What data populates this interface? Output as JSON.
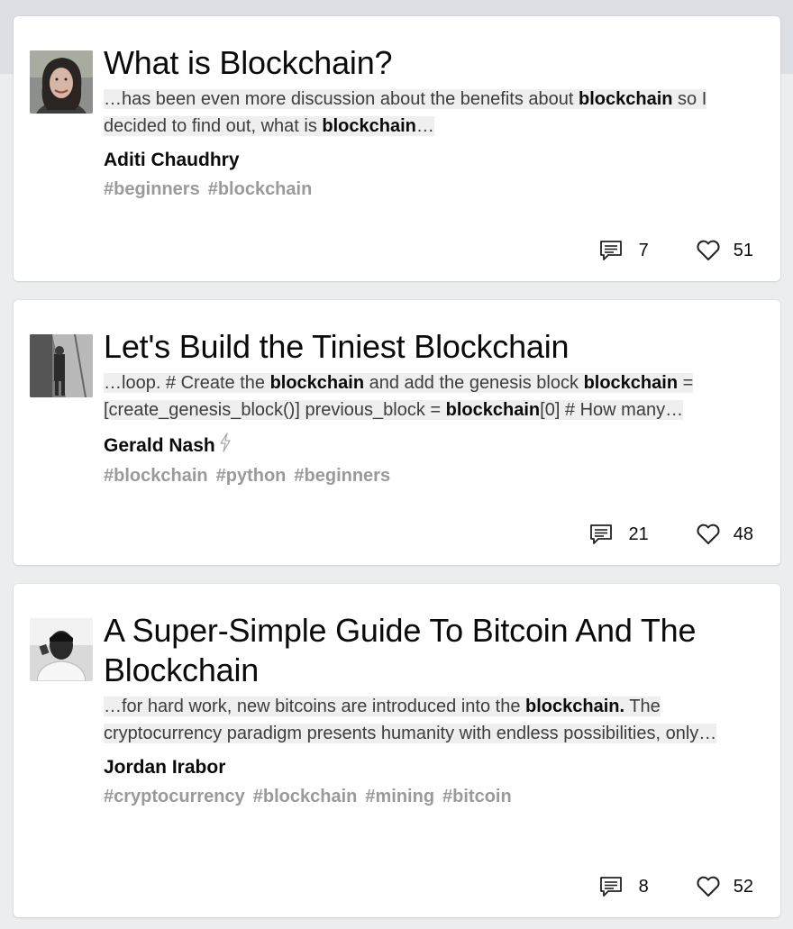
{
  "articles": [
    {
      "title": "What is Blockchain?",
      "snippet": [
        {
          "text": "…has been even more discussion about the benefits about ",
          "bold": false
        },
        {
          "text": "blockchain",
          "bold": true
        },
        {
          "text": " so I decided to find out, what is ",
          "bold": false
        },
        {
          "text": "blockchain",
          "bold": true
        },
        {
          "text": "…",
          "bold": false
        }
      ],
      "author": "Aditi Chaudhry",
      "tags": [
        "#beginners",
        "#blockchain"
      ],
      "comments": "7",
      "likes": "51"
    },
    {
      "title": "Let's Build the Tiniest Blockchain",
      "snippet": [
        {
          "text": "…loop. # Create the ",
          "bold": false
        },
        {
          "text": "blockchain",
          "bold": true
        },
        {
          "text": " and add the genesis block ",
          "bold": false
        },
        {
          "text": "blockchain",
          "bold": true
        },
        {
          "text": " = [create_genesis_block()] previous_block = ",
          "bold": false
        },
        {
          "text": "blockchain",
          "bold": true
        },
        {
          "text": "[0] # How many…",
          "bold": false
        }
      ],
      "author": "Gerald Nash",
      "tags": [
        "#blockchain",
        "#python",
        "#beginners"
      ],
      "comments": "21",
      "likes": "48"
    },
    {
      "title": "A Super-Simple Guide To Bitcoin And The Blockchain",
      "snippet": [
        {
          "text": "…for hard work, new bitcoins are introduced into the ",
          "bold": false
        },
        {
          "text": "blockchain.",
          "bold": true
        },
        {
          "text": " The cryptocurrency paradigm presents humanity with endless possibilities, only…",
          "bold": false
        }
      ],
      "author": "Jordan Irabor",
      "tags": [
        "#cryptocurrency",
        "#blockchain",
        "#mining",
        "#bitcoin"
      ],
      "comments": "8",
      "likes": "52"
    }
  ],
  "icons": {
    "comment": "comment-icon",
    "like": "heart-icon",
    "bolt": "lightning-bolt-icon"
  }
}
